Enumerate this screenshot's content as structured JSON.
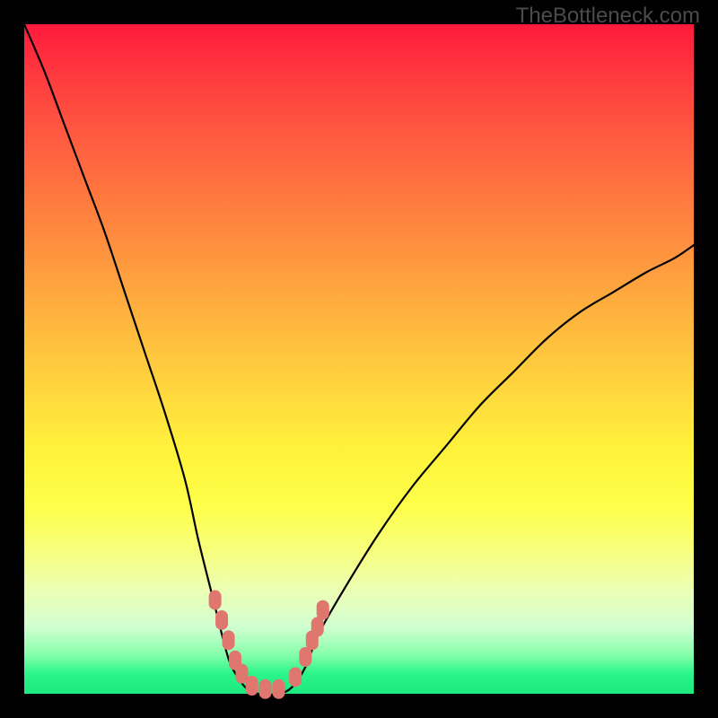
{
  "watermark": "TheBottleneck.com",
  "chart_data": {
    "type": "line",
    "title": "",
    "xlabel": "",
    "ylabel": "",
    "xlim": [
      0,
      100
    ],
    "ylim": [
      0,
      100
    ],
    "series": [
      {
        "name": "bottleneck-curve",
        "x": [
          0,
          3,
          6,
          9,
          12,
          15,
          18,
          21,
          24,
          26,
          28,
          29,
          30,
          31,
          33,
          35,
          38,
          40,
          42,
          44,
          48,
          53,
          58,
          63,
          68,
          73,
          78,
          83,
          88,
          93,
          97,
          100
        ],
        "values": [
          100,
          93,
          85,
          77,
          69,
          60,
          51,
          42,
          32,
          23,
          15,
          11,
          7,
          4,
          1,
          0,
          0,
          1,
          4,
          9,
          16,
          24,
          31,
          37,
          43,
          48,
          53,
          57,
          60,
          63,
          65,
          67
        ]
      }
    ],
    "markers": {
      "name": "highlight-dots",
      "color": "#e0776f",
      "points": [
        {
          "x": 28.5,
          "y": 14
        },
        {
          "x": 29.5,
          "y": 11
        },
        {
          "x": 30.5,
          "y": 8
        },
        {
          "x": 31.5,
          "y": 5
        },
        {
          "x": 32.5,
          "y": 3
        },
        {
          "x": 34.0,
          "y": 1.2
        },
        {
          "x": 36.0,
          "y": 0.7
        },
        {
          "x": 38.0,
          "y": 0.7
        },
        {
          "x": 40.5,
          "y": 2.5
        },
        {
          "x": 42.0,
          "y": 5.5
        },
        {
          "x": 43.0,
          "y": 8
        },
        {
          "x": 43.8,
          "y": 10
        },
        {
          "x": 44.6,
          "y": 12.5
        }
      ]
    },
    "gradient_stops": [
      {
        "pos": 0.0,
        "color": "#ff1a3d"
      },
      {
        "pos": 0.5,
        "color": "#ffcc3c"
      },
      {
        "pos": 0.8,
        "color": "#f6ff80"
      },
      {
        "pos": 1.0,
        "color": "#1de97e"
      }
    ]
  }
}
